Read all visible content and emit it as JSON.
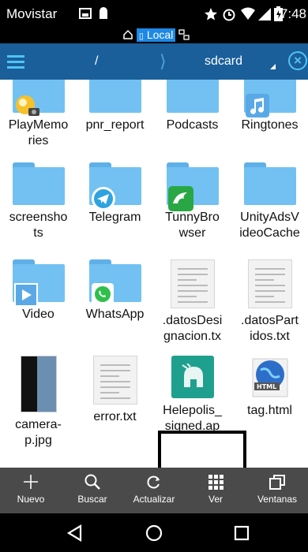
{
  "status": {
    "carrier": "Movistar",
    "time": "7:48"
  },
  "location_chip": {
    "label": "Local"
  },
  "toolbar": {
    "root": "/",
    "current": "sdcard"
  },
  "files": [
    {
      "name": "PlayMemories",
      "label": "PlayMemo\nries",
      "kind": "folder",
      "badge": "playmemories-icon"
    },
    {
      "name": "pnr_report",
      "label": "pnr_report",
      "kind": "folder"
    },
    {
      "name": "Podcasts",
      "label": "Podcasts",
      "kind": "folder"
    },
    {
      "name": "Ringtones",
      "label": "Ringtones",
      "kind": "folder",
      "badge": "music-note-icon"
    },
    {
      "name": "screenshots",
      "label": "screensho\nts",
      "kind": "folder"
    },
    {
      "name": "Telegram",
      "label": "Telegram",
      "kind": "folder",
      "badge": "telegram-icon"
    },
    {
      "name": "TunnyBrowser",
      "label": "TunnyBro\nwser",
      "kind": "folder",
      "badge": "dolphin-icon"
    },
    {
      "name": "UnityAdsVideoCache",
      "label": "UnityAdsV\nideoCache",
      "kind": "folder"
    },
    {
      "name": "Video",
      "label": "Video",
      "kind": "folder",
      "badge": "play-icon"
    },
    {
      "name": "WhatsApp",
      "label": "WhatsApp",
      "kind": "folder",
      "badge": "whatsapp-icon"
    },
    {
      "name": ".datosDesignacion.txt",
      "label": ".datosDesi\ngnacion.tx",
      "kind": "doc"
    },
    {
      "name": ".datosPartidos.txt",
      "label": ".datosPart\nidos.txt",
      "kind": "doc"
    },
    {
      "name": "camera-p.jpg",
      "label": "camera-\np.jpg",
      "kind": "image"
    },
    {
      "name": "error.txt",
      "label": "error.txt",
      "kind": "doc"
    },
    {
      "name": "Helepolis_signed.apk",
      "label": "Helepolis_\nsigned.ap",
      "kind": "apk"
    },
    {
      "name": "tag.html",
      "label": "tag.html",
      "kind": "html"
    }
  ],
  "actions": [
    {
      "label": "Nuevo",
      "icon": "plus-icon"
    },
    {
      "label": "Buscar",
      "icon": "search-icon"
    },
    {
      "label": "Actualizar",
      "icon": "refresh-icon"
    },
    {
      "label": "Ver",
      "icon": "grid-view-icon"
    },
    {
      "label": "Ventanas",
      "icon": "windows-icon"
    }
  ],
  "colors": {
    "toolbar": "#1a5f99",
    "folder": "#72c1f2",
    "accent": "#4fc3f7",
    "actionbar": "#4a4a4a"
  }
}
